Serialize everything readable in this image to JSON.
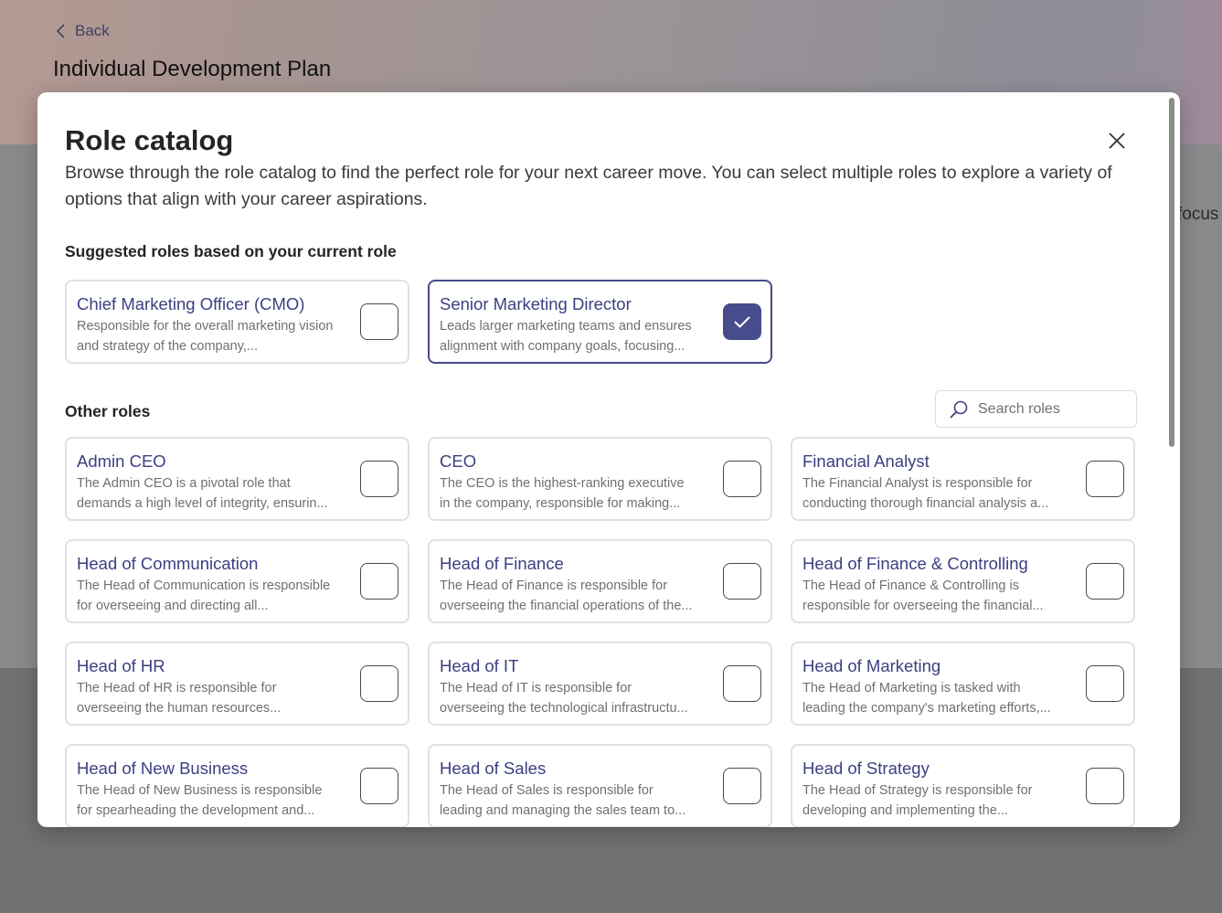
{
  "background": {
    "back_label": "Back",
    "page_title": "Individual Development Plan",
    "partial_text": "focus"
  },
  "modal": {
    "title": "Role catalog",
    "description": "Browse through the role catalog to find the perfect role for your next career move. You can select multiple roles to explore a variety of options that align with your career aspirations.",
    "suggested_label": "Suggested roles based on your current role",
    "other_label": "Other roles",
    "search_placeholder": "Search roles",
    "suggested_roles": [
      {
        "title": "Chief Marketing Officer (CMO)",
        "desc": "Responsible for the overall marketing vision and strategy of the company,...",
        "checked": false
      },
      {
        "title": "Senior Marketing Director",
        "desc": "Leads larger marketing teams and ensures alignment with company goals, focusing...",
        "checked": true
      }
    ],
    "other_roles": [
      {
        "title": "Admin CEO",
        "desc": "The Admin CEO is a pivotal role that demands a high level of integrity, ensurin...",
        "checked": false
      },
      {
        "title": "CEO",
        "desc": "The CEO is the highest-ranking executive in the company, responsible for making...",
        "checked": false
      },
      {
        "title": "Financial Analyst",
        "desc": "The Financial Analyst is responsible for conducting thorough financial analysis a...",
        "checked": false
      },
      {
        "title": "Head of Communication",
        "desc": "The Head of Communication is responsible for overseeing and directing all...",
        "checked": false
      },
      {
        "title": "Head of Finance",
        "desc": "The Head of Finance is responsible for overseeing the financial operations of the...",
        "checked": false
      },
      {
        "title": "Head of Finance & Controlling",
        "desc": "The Head of Finance & Controlling is responsible for overseeing the financial...",
        "checked": false
      },
      {
        "title": "Head of HR",
        "desc": "The Head of HR is responsible for overseeing the human resources...",
        "checked": false
      },
      {
        "title": "Head of IT",
        "desc": "The Head of IT is responsible for overseeing the technological infrastructu...",
        "checked": false
      },
      {
        "title": "Head of Marketing",
        "desc": "The Head of Marketing is tasked with leading the company's marketing efforts,...",
        "checked": false
      },
      {
        "title": "Head of New Business",
        "desc": "The Head of New Business is responsible for spearheading the development and...",
        "checked": false
      },
      {
        "title": "Head of Sales",
        "desc": "The Head of Sales is responsible for leading and managing the sales team to...",
        "checked": false
      },
      {
        "title": "Head of Strategy",
        "desc": "The Head of Strategy is responsible for developing and implementing the...",
        "checked": false
      }
    ]
  },
  "colors": {
    "accent": "#474c8c",
    "title_text": "#3b3f80"
  }
}
